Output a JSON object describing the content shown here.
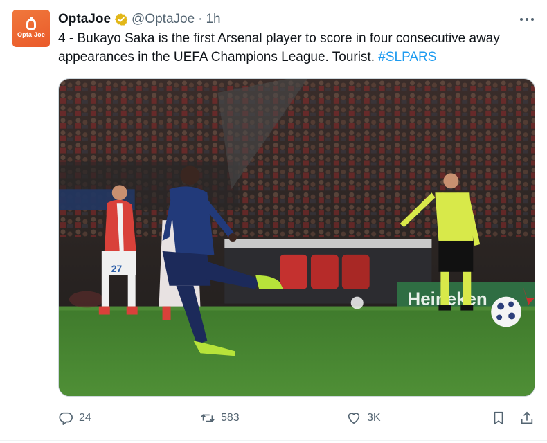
{
  "account": {
    "display_name": "OptaJoe",
    "handle": "@OptaJoe",
    "separator": "·",
    "time": "1h",
    "avatar_text": "Opta Joe",
    "verified_icon": "verified-gold-badge",
    "avatar_color": "#ea5a2a"
  },
  "tweet": {
    "text": "4 - Bukayo Saka is the first Arsenal player to score in four consecutive away appearances in the UEFA Champions League. Tourist.",
    "hashtag": "#SLPARS",
    "hashtag_color": "#1d9bf0"
  },
  "media": {
    "board_text": "Heineken",
    "shirt_number": "27"
  },
  "actions": {
    "reply_count": "24",
    "retweet_count": "583",
    "like_count": "3K",
    "reply_icon": "reply-icon",
    "retweet_icon": "retweet-icon",
    "like_icon": "heart-icon",
    "bookmark_icon": "bookmark-icon",
    "share_icon": "share-icon",
    "icon_color": "#536471"
  }
}
